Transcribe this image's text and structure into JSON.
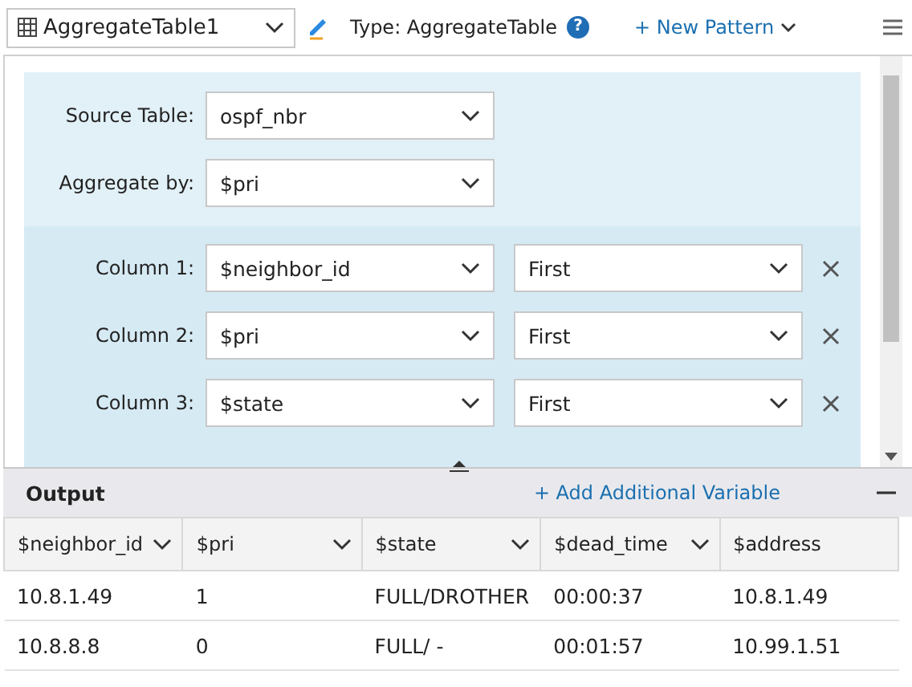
{
  "toolbar": {
    "table_select": "AggregateTable1",
    "type_label": "Type: AggregateTable",
    "new_pattern": "+ New Pattern",
    "help": "?"
  },
  "source_table": {
    "label": "Source Table:",
    "value": "ospf_nbr"
  },
  "aggregate_by": {
    "label": "Aggregate by:",
    "value": "$pri"
  },
  "columns": [
    {
      "label": "Column 1:",
      "variable": "$neighbor_id",
      "function": "First"
    },
    {
      "label": "Column 2:",
      "variable": "$pri",
      "function": "First"
    },
    {
      "label": "Column 3:",
      "variable": "$state",
      "function": "First"
    }
  ],
  "output": {
    "title": "Output",
    "add_variable": "+ Add Additional Variable",
    "table": {
      "columns": [
        {
          "label": "$neighbor_id",
          "kind": "dropdown"
        },
        {
          "label": "$pri",
          "kind": "dropdown"
        },
        {
          "label": "$state",
          "kind": "dropdown"
        },
        {
          "label": "$dead_time",
          "kind": "dropdown"
        },
        {
          "label": "$address",
          "kind": "plain"
        }
      ],
      "rows": [
        [
          "10.8.1.49",
          "1",
          "FULL/DROTHER",
          "00:00:37",
          "10.8.1.49"
        ],
        [
          "10.8.8.8",
          "0",
          "FULL/ -",
          "00:01:57",
          "10.99.1.51"
        ]
      ]
    }
  }
}
